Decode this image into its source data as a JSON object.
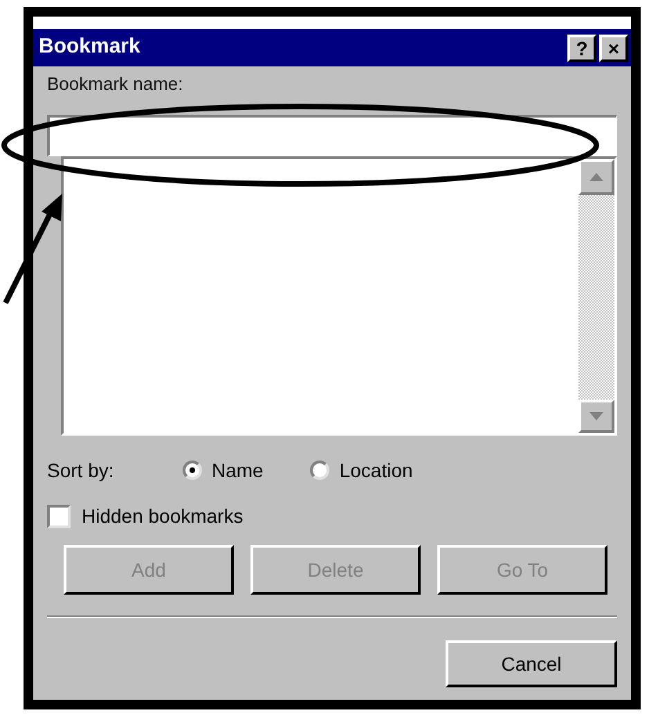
{
  "window": {
    "title": "Bookmark",
    "title_buttons": [
      "?",
      "×"
    ]
  },
  "name_field": {
    "label": "Bookmark name:"
  },
  "sort": {
    "label": "Sort by:",
    "options": [
      {
        "label": "Name",
        "selected": true
      },
      {
        "label": "Location",
        "selected": false
      }
    ]
  },
  "hidden_bookmarks": {
    "label": "Hidden bookmarks",
    "checked": false
  },
  "buttons": [
    {
      "label": "Add",
      "disabled": true
    },
    {
      "label": "Delete",
      "disabled": true
    },
    {
      "label": "Go To",
      "disabled": true
    }
  ],
  "cancel_button": {
    "label": "Cancel"
  },
  "annotations": {
    "highlight_ellipse": true,
    "pointer_arrow": true
  }
}
